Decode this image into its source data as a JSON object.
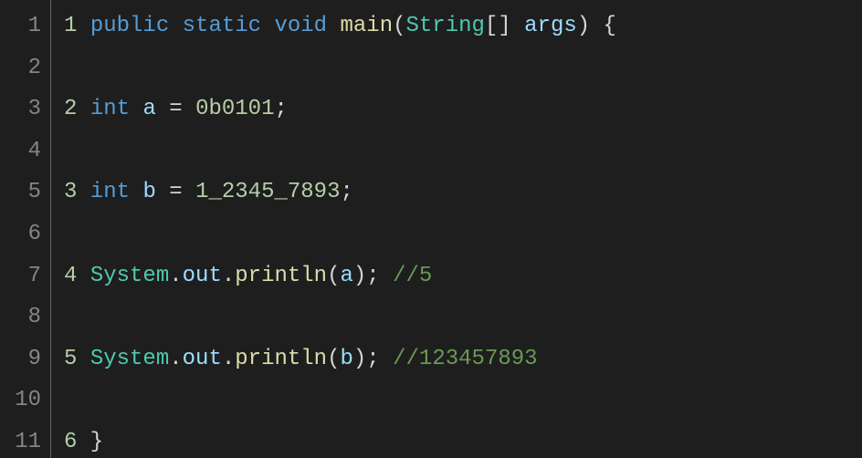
{
  "editor": {
    "gutter": [
      "1",
      "2",
      "3",
      "4",
      "5",
      "6",
      "7",
      "8",
      "9",
      "10",
      "11"
    ],
    "lines": [
      [
        {
          "cls": "tok-num",
          "t": "1"
        },
        {
          "cls": "tok-punc",
          "t": " "
        },
        {
          "cls": "tok-kw",
          "t": "public"
        },
        {
          "cls": "tok-punc",
          "t": " "
        },
        {
          "cls": "tok-kw",
          "t": "static"
        },
        {
          "cls": "tok-punc",
          "t": " "
        },
        {
          "cls": "tok-kw",
          "t": "void"
        },
        {
          "cls": "tok-punc",
          "t": " "
        },
        {
          "cls": "tok-method",
          "t": "main"
        },
        {
          "cls": "tok-punc",
          "t": "("
        },
        {
          "cls": "tok-type",
          "t": "String"
        },
        {
          "cls": "tok-punc",
          "t": "[] "
        },
        {
          "cls": "tok-ident",
          "t": "args"
        },
        {
          "cls": "tok-punc",
          "t": ") {"
        }
      ],
      [],
      [
        {
          "cls": "tok-num",
          "t": "2"
        },
        {
          "cls": "tok-punc",
          "t": " "
        },
        {
          "cls": "tok-kw",
          "t": "int"
        },
        {
          "cls": "tok-punc",
          "t": " "
        },
        {
          "cls": "tok-ident",
          "t": "a"
        },
        {
          "cls": "tok-punc",
          "t": " = "
        },
        {
          "cls": "tok-num",
          "t": "0b0101"
        },
        {
          "cls": "tok-punc",
          "t": ";"
        }
      ],
      [],
      [
        {
          "cls": "tok-num",
          "t": "3"
        },
        {
          "cls": "tok-punc",
          "t": " "
        },
        {
          "cls": "tok-kw",
          "t": "int"
        },
        {
          "cls": "tok-punc",
          "t": " "
        },
        {
          "cls": "tok-ident",
          "t": "b"
        },
        {
          "cls": "tok-punc",
          "t": " = "
        },
        {
          "cls": "tok-num",
          "t": "1_2345_7893"
        },
        {
          "cls": "tok-punc",
          "t": ";"
        }
      ],
      [],
      [
        {
          "cls": "tok-num",
          "t": "4"
        },
        {
          "cls": "tok-punc",
          "t": " "
        },
        {
          "cls": "tok-type",
          "t": "System"
        },
        {
          "cls": "tok-punc",
          "t": "."
        },
        {
          "cls": "tok-ident",
          "t": "out"
        },
        {
          "cls": "tok-punc",
          "t": "."
        },
        {
          "cls": "tok-method",
          "t": "println"
        },
        {
          "cls": "tok-punc",
          "t": "("
        },
        {
          "cls": "tok-ident",
          "t": "a"
        },
        {
          "cls": "tok-punc",
          "t": "); "
        },
        {
          "cls": "tok-comment",
          "t": "//5"
        }
      ],
      [],
      [
        {
          "cls": "tok-num",
          "t": "5"
        },
        {
          "cls": "tok-punc",
          "t": " "
        },
        {
          "cls": "tok-type",
          "t": "System"
        },
        {
          "cls": "tok-punc",
          "t": "."
        },
        {
          "cls": "tok-ident",
          "t": "out"
        },
        {
          "cls": "tok-punc",
          "t": "."
        },
        {
          "cls": "tok-method",
          "t": "println"
        },
        {
          "cls": "tok-punc",
          "t": "("
        },
        {
          "cls": "tok-ident",
          "t": "b"
        },
        {
          "cls": "tok-punc",
          "t": "); "
        },
        {
          "cls": "tok-comment",
          "t": "//123457893"
        }
      ],
      [],
      [
        {
          "cls": "tok-num",
          "t": "6"
        },
        {
          "cls": "tok-punc",
          "t": " }"
        }
      ]
    ]
  }
}
